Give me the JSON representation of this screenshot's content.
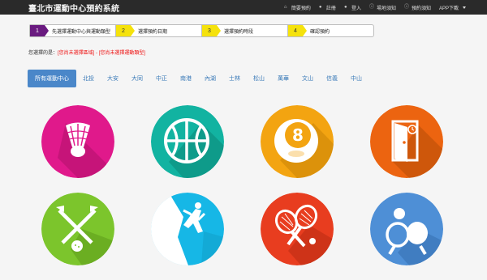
{
  "brand": "臺北市運動中心預約系統",
  "nav": [
    {
      "icon": "home-icon",
      "glyph": "⌂",
      "label": "簡要預約"
    },
    {
      "icon": "user-icon",
      "glyph": "●",
      "label": "註冊"
    },
    {
      "icon": "user-login-icon",
      "glyph": "●",
      "label": "登入"
    },
    {
      "icon": "info-icon",
      "glyph": "ⓘ",
      "label": "場地須知"
    },
    {
      "icon": "info-icon",
      "glyph": "ⓘ",
      "label": "預約須知"
    },
    {
      "icon": "dropdown-icon",
      "glyph": "",
      "label": "APP下載"
    }
  ],
  "steps": [
    {
      "num": "1",
      "label": "先選擇運動中心與運動類型"
    },
    {
      "num": "2",
      "label": "選擇預約日期"
    },
    {
      "num": "3",
      "label": "選擇預約時段"
    },
    {
      "num": "4",
      "label": "確認預約"
    }
  ],
  "selection": {
    "prefix": "您選擇的是：",
    "venue": "[您尚未選擇區域]",
    "sep": " - ",
    "sport": "[您尚未選擇運動類型]"
  },
  "tabs": [
    "所有運動中心",
    "北投",
    "大安",
    "大同",
    "中正",
    "南港",
    "內湖",
    "士林",
    "松山",
    "萬華",
    "文山",
    "信義",
    "中山"
  ],
  "colors": {
    "accent": "#4a87c9",
    "step_active": "#6a1b80",
    "step_other": "#f5e20c",
    "navbar": "#2a2a2a",
    "badminton": "#e0198b",
    "basketball": "#12b3a1",
    "billiards": "#f3a411",
    "fitness": "#ec6410",
    "golf": "#7cc52c",
    "climbing": "#16b7e6",
    "tennis": "#e83d1f",
    "tabletennis": "#4e8fd6"
  },
  "sports": [
    {
      "name": "sport-badminton-icon"
    },
    {
      "name": "sport-basketball-icon"
    },
    {
      "name": "sport-billiards-icon"
    },
    {
      "name": "sport-fitness-icon"
    },
    {
      "name": "sport-golf-icon"
    },
    {
      "name": "sport-climbing-icon"
    },
    {
      "name": "sport-tennis-icon"
    },
    {
      "name": "sport-tabletennis-icon"
    }
  ]
}
